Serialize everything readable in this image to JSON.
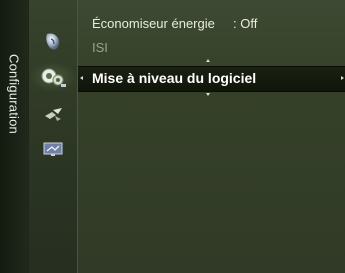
{
  "side_tab": {
    "label": "Configuration"
  },
  "menu": {
    "items": [
      {
        "label": "Économiseur énergie",
        "value": ": Off",
        "state": "normal"
      },
      {
        "label": "ISI",
        "state": "disabled"
      },
      {
        "label": "Mise à niveau du logiciel",
        "state": "selected"
      }
    ]
  },
  "icons": {
    "sidebar": [
      "picture-icon",
      "setup-icon",
      "satellite-dish-icon",
      "tv-input-icon"
    ]
  },
  "colors": {
    "panel": "#364129",
    "highlight": "#12170b",
    "text": "#e7ecdf",
    "disabled_text": "#9aa38e"
  }
}
